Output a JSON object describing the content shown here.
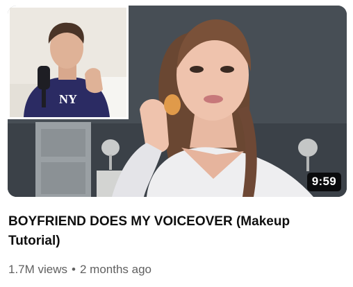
{
  "video": {
    "duration": "9:59",
    "title": "BOYFRIEND DOES MY VOICEOVER (Makeup Tutorial)",
    "views": "1.7M views",
    "separator": "•",
    "age": "2 months ago"
  },
  "thumbnail": {
    "inset_shirt_logo": "NY"
  },
  "colors": {
    "title": "#0f0f0f",
    "meta": "#606060",
    "duration_bg": "#000000",
    "duration_text": "#ffffff"
  }
}
